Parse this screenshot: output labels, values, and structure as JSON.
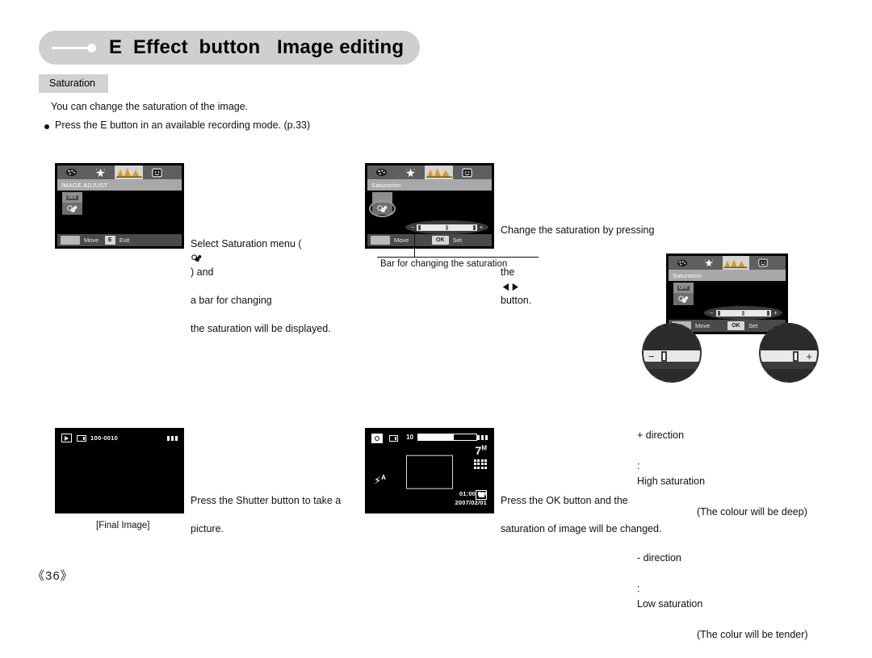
{
  "header": {
    "title": "E  Effect  button   Image editing",
    "section_label": "Saturation"
  },
  "intro": {
    "line1": "You can change the saturation of the image.",
    "bullet1": "Press the E button in an available recording mode. (p.33)"
  },
  "lcd_menu": {
    "title": "IMAGE ADJUST",
    "tabs": [
      "palette-icon",
      "sparkle-icon",
      "histogram-icon",
      "face-icon"
    ],
    "selected_tab_index": 2,
    "footer": {
      "move_label": "Move",
      "e_key": "E",
      "exit_label": "Exit"
    },
    "option_off_label": "OFF"
  },
  "lcd_saturation": {
    "title": "Saturation",
    "footer": {
      "move_label": "Move",
      "ok_key": "OK",
      "set_label": "Set"
    },
    "slider": {
      "minus": "−",
      "plus": "+"
    }
  },
  "captions": {
    "select_saturation": "Select Saturation menu (  ) and\na bar for changing\nthe saturation will be displayed.",
    "select_saturation_l1a": "Select Saturation menu (",
    "select_saturation_l1b": ") and",
    "select_saturation_l2": "a bar for changing",
    "select_saturation_l3": "the saturation will be displayed.",
    "change_saturation_l1": "Change the saturation by pressing",
    "change_saturation_l2a": "the",
    "change_saturation_l2b": "button.",
    "bar_caption": "Bar for changing the saturation",
    "shutter_l1": "Press the Shutter button to take a",
    "shutter_l2": "picture.",
    "ok_l1": "Press the OK button and the",
    "ok_l2": "saturation of image will be changed.",
    "final_image": "[Final Image]"
  },
  "direction_notes": {
    "plus_label": "+ direction",
    "plus_colon": ":",
    "plus_value": "High saturation",
    "plus_sub": "(The colour will be deep)",
    "minus_label": "- direction",
    "minus_colon": ":",
    "minus_value": "Low saturation",
    "minus_sub": "(The colur will be tender)"
  },
  "lcd_playback": {
    "file_number": "100-0010",
    "play_icon": "play-icon",
    "card_icon": "memory-card-icon",
    "battery_icon": "battery-icon"
  },
  "lcd_record": {
    "shots_remaining": "10",
    "resolution": "7",
    "resolution_sup": "M",
    "flash_mode": "A",
    "time": "01:00 PM",
    "date": "2007/02/01",
    "camera_icon": "camera-mode-icon",
    "card_icon": "memory-card-icon",
    "grid_icon": "fine-quality-icon",
    "af_frame": "autofocus-frame",
    "metering_icon": "metering-icon",
    "battery_icon": "battery-icon"
  },
  "footer": {
    "page_number": "《36》"
  },
  "colors": {
    "header_pill": "#cfcfcf",
    "section_label": "#d2d2d2",
    "lcd_black": "#000000",
    "menu_bar": "#5e5e5e",
    "title_bar": "#a8a8a8",
    "foot_bar": "#4a4a4a"
  }
}
